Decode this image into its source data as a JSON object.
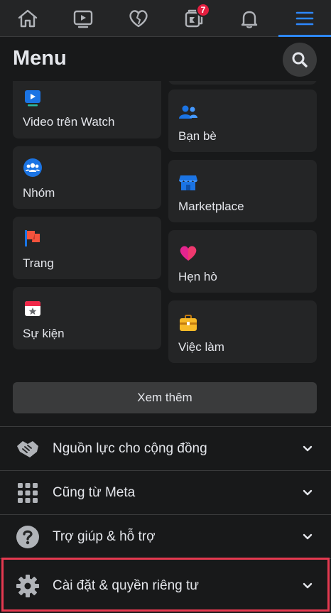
{
  "nav": {
    "items": [
      {
        "name": "home-icon"
      },
      {
        "name": "watch-icon"
      },
      {
        "name": "dating-icon"
      },
      {
        "name": "pages-icon",
        "badge": "7"
      },
      {
        "name": "bell-icon"
      },
      {
        "name": "menu-icon",
        "active": true
      }
    ]
  },
  "header": {
    "title": "Menu",
    "search_icon": "search-icon"
  },
  "shortcuts": {
    "left": [
      {
        "label": "Video trên Watch",
        "icon": "watch-video-icon",
        "color": "#1b74e4"
      },
      {
        "label": "Nhóm",
        "icon": "groups-icon",
        "color": "#1b74e4"
      },
      {
        "label": "Trang",
        "icon": "flag-icon",
        "color": "#f5533d"
      },
      {
        "label": "Sự kiện",
        "icon": "calendar-icon",
        "color": "#f02849"
      }
    ],
    "right": [
      {
        "label": "Bạn bè",
        "icon": "friends-icon",
        "color": "#1b74e4"
      },
      {
        "label": "Marketplace",
        "icon": "marketplace-icon",
        "color": "#1b74e4"
      },
      {
        "label": "Hẹn hò",
        "icon": "heart-icon",
        "color": "#e4258f"
      },
      {
        "label": "Việc làm",
        "icon": "briefcase-icon",
        "color": "#f7b928"
      }
    ]
  },
  "see_more": "Xem thêm",
  "sections": [
    {
      "label": "Nguồn lực cho cộng đồng",
      "icon": "handshake-icon"
    },
    {
      "label": "Cũng từ Meta",
      "icon": "grid-icon"
    },
    {
      "label": "Trợ giúp & hỗ trợ",
      "icon": "help-icon"
    },
    {
      "label": "Cài đặt & quyền riêng tư",
      "icon": "gear-icon"
    }
  ],
  "colors": {
    "accent": "#2d88ff",
    "badge": "#e41e3f",
    "highlight": "#e53950",
    "background": "#18191a",
    "card": "#242526"
  }
}
